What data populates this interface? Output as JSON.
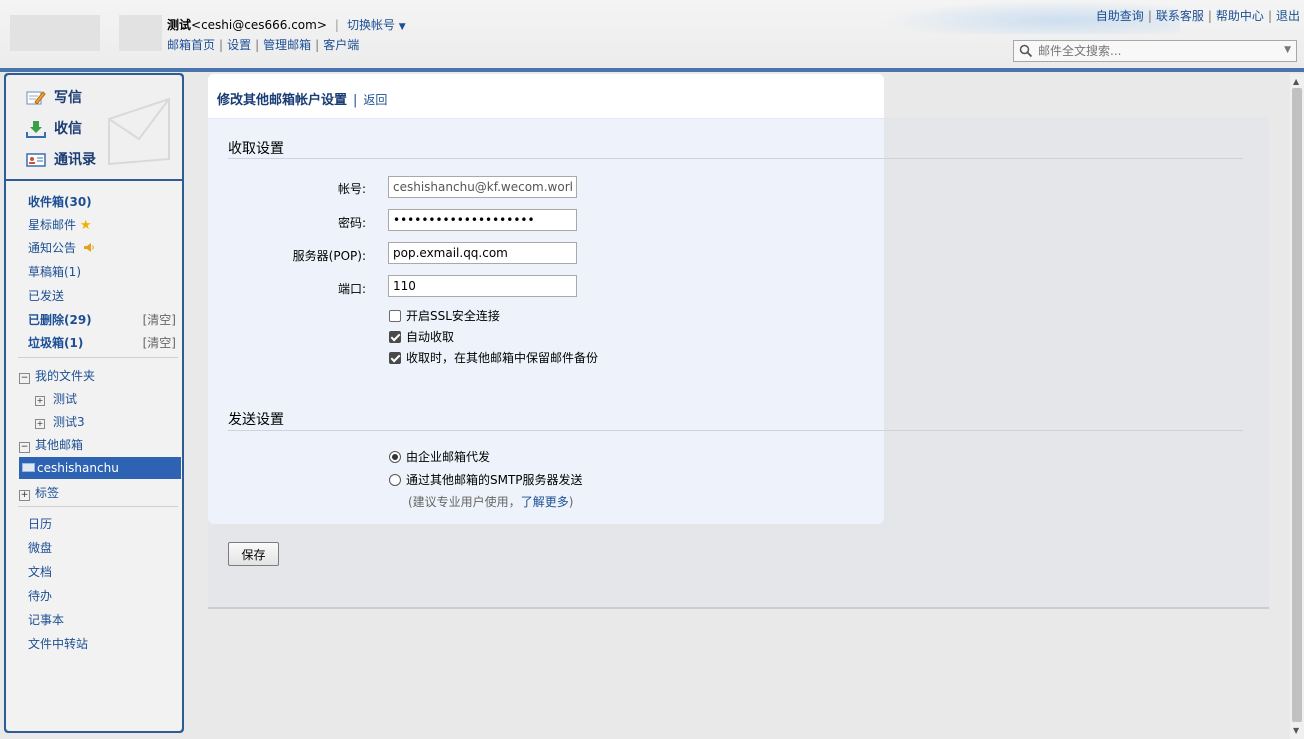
{
  "header": {
    "account_name": "测试",
    "account_email": "<ceshi@ces666.com>",
    "separator": "|",
    "switch_label": "切换帐号",
    "nav_links": [
      "邮箱首页",
      "设置",
      "管理邮箱",
      "客户端"
    ],
    "right_links": [
      "自助查询",
      "联系客服",
      "帮助中心",
      "退出"
    ],
    "search_placeholder": "邮件全文搜索..."
  },
  "sidebar": {
    "actions": [
      "写信",
      "收信",
      "通讯录"
    ],
    "inbox": "收件箱(30)",
    "starred": "星标邮件",
    "notice": "通知公告",
    "drafts": "草稿箱(1)",
    "sent": "已发送",
    "deleted": "已删除(29)",
    "spam": "垃圾箱(1)",
    "clear_label": "[清空]",
    "my_folders": "我的文件夹",
    "folders": [
      "测试",
      "测试3"
    ],
    "other_mailboxes": "其他邮箱",
    "other_account": "ceshishanchu",
    "tags": "标签",
    "tools": [
      "日历",
      "微盘",
      "文档",
      "待办",
      "记事本",
      "文件中转站"
    ]
  },
  "page": {
    "title": "修改其他邮箱帐户设置",
    "sep": "|",
    "back": "返回",
    "receive_section": "收取设置",
    "send_section": "发送设置",
    "fields": {
      "account_label": "帐号:",
      "account_value": "ceshishanchu@kf.wecom.work",
      "password_label": "密码:",
      "password_value": "abcdefghijklmnopqrst",
      "server_label": "服务器(POP):",
      "server_value": "pop.exmail.qq.com",
      "port_label": "端口:",
      "port_value": "110"
    },
    "checkboxes": [
      {
        "label": "开启SSL安全连接",
        "checked": false
      },
      {
        "label": "自动收取",
        "checked": true
      },
      {
        "label": "收取时，在其他邮箱中保留邮件备份",
        "checked": true
      }
    ],
    "send_options": [
      {
        "label": "由企业邮箱代发",
        "selected": true
      },
      {
        "label": "通过其他邮箱的SMTP服务器发送",
        "selected": false
      }
    ],
    "hint_prefix": "(建议专业用户使用，",
    "hint_link": "了解更多",
    "hint_suffix": ")",
    "save_button": "保存"
  },
  "colors": {
    "accent": "#1d4f94",
    "sidebar_frame": "#2e5c97",
    "selected_item": "#2e63b3",
    "header_bar": "#4a74ac"
  }
}
